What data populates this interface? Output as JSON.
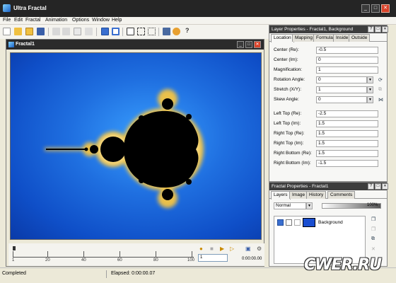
{
  "app": {
    "title": "Ultra Fractal"
  },
  "menu": [
    "File",
    "Edit",
    "Fractal",
    "Animation",
    "Options",
    "Window",
    "Help"
  ],
  "fractal_window": {
    "title": "Fractal1"
  },
  "timeline": {
    "ticks": [
      "1",
      "20",
      "40",
      "60",
      "80",
      "100"
    ],
    "frame_value": "1",
    "time": "0:00:00.00"
  },
  "status": {
    "state": "Completed",
    "elapsed": "Elapsed: 0:00:00.07"
  },
  "layer_properties": {
    "title": "Layer Properties - Fractal1, Background",
    "tabs": [
      "Location",
      "Mapping",
      "Formula",
      "Inside",
      "Outside"
    ],
    "fields": [
      {
        "label": "Center (Re):",
        "value": "-0.5"
      },
      {
        "label": "Center (Im):",
        "value": "0"
      },
      {
        "label": "Magnification:",
        "value": "1"
      },
      {
        "label": "Rotation Angle:",
        "value": "0"
      },
      {
        "label": "Stretch (X/Y):",
        "value": "1"
      },
      {
        "label": "Skew Angle:",
        "value": "0"
      },
      {
        "label": "Left Top (Re):",
        "value": "-2.5"
      },
      {
        "label": "Left Top (Im):",
        "value": "1.5"
      },
      {
        "label": "Right Top (Re):",
        "value": "1.5"
      },
      {
        "label": "Right Top (Im):",
        "value": "1.5"
      },
      {
        "label": "Right Bottom (Re):",
        "value": "1.5"
      },
      {
        "label": "Right Bottom (Im):",
        "value": "-1.5"
      }
    ]
  },
  "fractal_properties": {
    "title": "Fractal Properties - Fractal1",
    "tabs": [
      "Layers",
      "Image",
      "History",
      "Comments"
    ],
    "blend_mode": "Normal",
    "opacity": "100%",
    "layer_name": "Background"
  },
  "watermark": "CWER.RU",
  "colors": {
    "titlebar": "#252525",
    "canvas_blue": "#1f6fe0",
    "set_fill": "#000000",
    "edge_glow": "#f5c542"
  }
}
